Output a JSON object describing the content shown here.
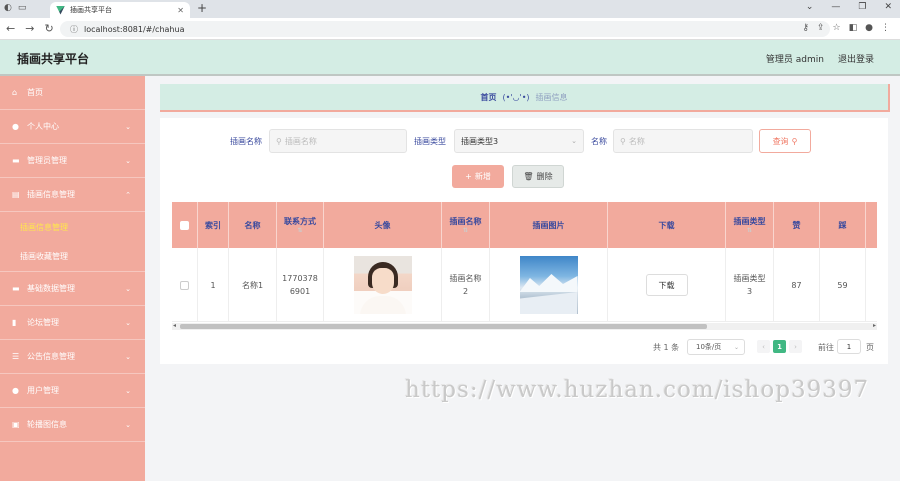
{
  "browser": {
    "tab_title": "插画共享平台",
    "url": "localhost:8081/#/chahua"
  },
  "header": {
    "app_title": "插画共享平台",
    "user_label": "管理员 admin",
    "logout_label": "退出登录"
  },
  "sidebar": {
    "items": [
      {
        "label": "首页",
        "icon": "home-icon"
      },
      {
        "label": "个人中心",
        "icon": "user-icon"
      },
      {
        "label": "管理员管理",
        "icon": "briefcase-icon"
      },
      {
        "label": "插画信息管理",
        "icon": "clipboard-icon"
      },
      {
        "label": "插画信息管理",
        "sub": true,
        "active": true
      },
      {
        "label": "插画收藏管理",
        "sub": true
      },
      {
        "label": "基础数据管理",
        "icon": "database-icon"
      },
      {
        "label": "论坛管理",
        "icon": "chart-icon"
      },
      {
        "label": "公告信息管理",
        "icon": "list-icon"
      },
      {
        "label": "用户管理",
        "icon": "user-icon"
      },
      {
        "label": "轮播图信息",
        "icon": "image-icon"
      }
    ]
  },
  "breadcrumb": {
    "home": "首页",
    "separator": "(•'◡'•)",
    "current": "插画信息"
  },
  "search": {
    "name_label": "插画名称",
    "name_placeholder": "插画名称",
    "type_label": "插画类型",
    "type_value": "插画类型3",
    "title_label": "名称",
    "title_placeholder": "名称",
    "query_button": "查询"
  },
  "actions": {
    "add_label": "新增",
    "delete_label": "删除"
  },
  "table": {
    "headers": [
      "索引",
      "名称",
      "联系方式",
      "头像",
      "插画名称",
      "插画图片",
      "下载",
      "插画类型",
      "赞",
      "踩"
    ],
    "rows": [
      {
        "index": "1",
        "name": "名称1",
        "contact": "17703786901",
        "title": "插画名称2",
        "download": "下载",
        "type": "插画类型3",
        "likes": "87",
        "dislikes": "59"
      }
    ]
  },
  "pagination": {
    "total": "共 1 条",
    "page_size": "10条/页",
    "current_page": "1",
    "goto_label": "前往",
    "goto_value": "1",
    "page_suffix": "页"
  },
  "watermark": "https://www.huzhan.com/ishop39397",
  "colors": {
    "header_bg": "#d4ede4",
    "sidebar_bg": "#f2aa9d",
    "accent_blue": "#3a4a9e",
    "active_page": "#41b883"
  }
}
